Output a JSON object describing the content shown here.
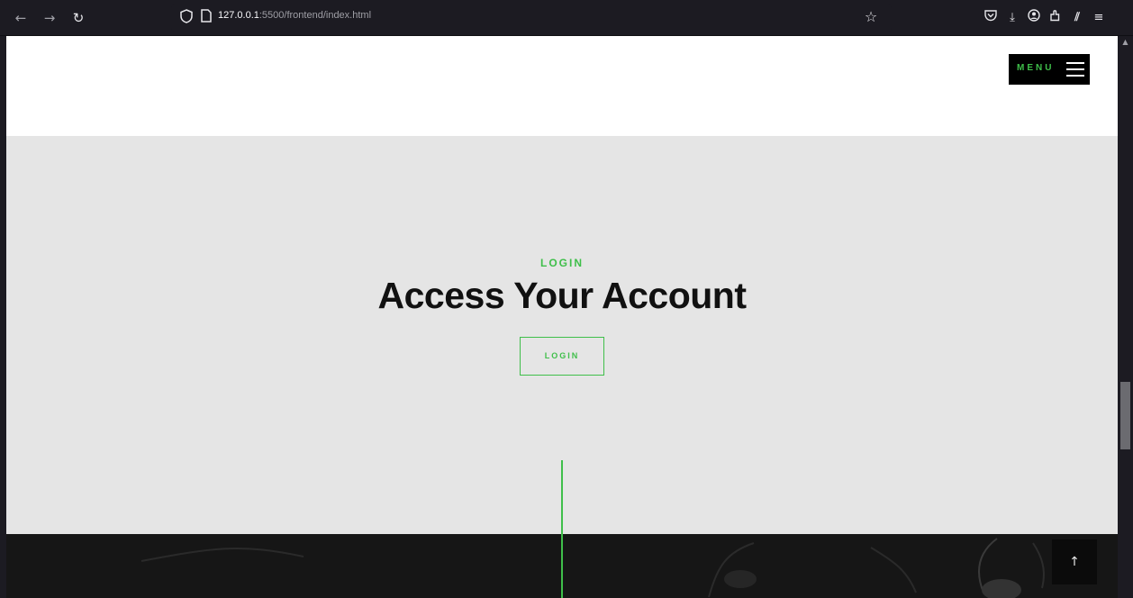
{
  "browser": {
    "url_host": "127.0.0.1",
    "url_path": ":5500/frontend/index.html",
    "icons": {
      "back": "arrow-left-icon",
      "forward": "arrow-right-icon",
      "reload": "reload-icon",
      "shield": "shield-icon",
      "page": "page-icon",
      "bookmark": "star-icon",
      "pocket": "pocket-icon",
      "downloads": "download-icon",
      "account": "account-icon",
      "extensions": "extensions-icon",
      "reader": "reader-icon",
      "menu": "hamburger-menu-icon"
    }
  },
  "header": {
    "menu_label": "MENU"
  },
  "hero": {
    "eyebrow": "LOGIN",
    "title": "Access Your Account",
    "button_label": "LOGIN"
  },
  "footer": {
    "back_to_top_icon": "↑"
  },
  "colors": {
    "accent": "#3fbf4a",
    "hero_bg": "#e5e5e5",
    "dark_bg": "#161616",
    "chrome_bg": "#1c1b22"
  }
}
